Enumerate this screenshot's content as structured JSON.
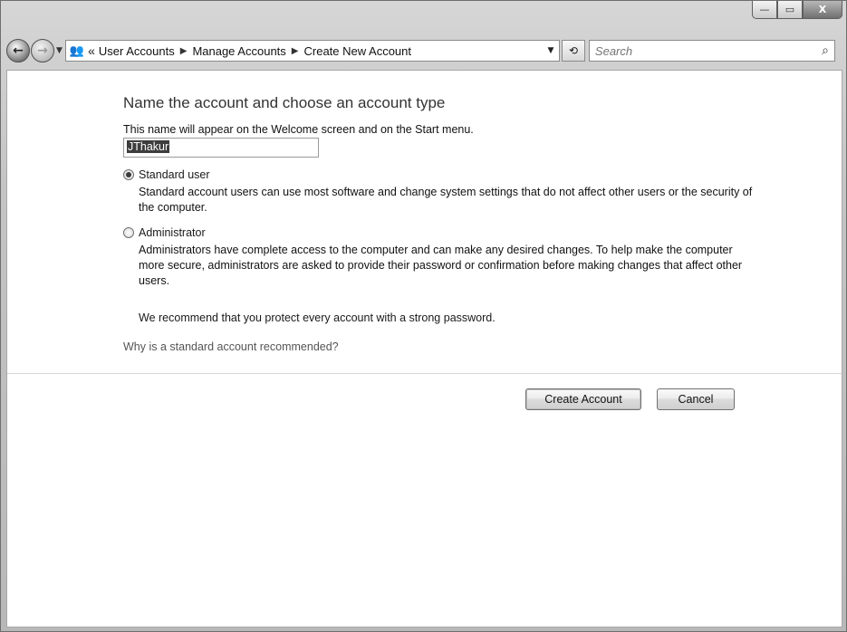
{
  "window": {
    "controls": {
      "minimize": "—",
      "maximize": "▭",
      "close": "X"
    }
  },
  "navbar": {
    "back_icon": "back-arrow-icon",
    "forward_icon": "forward-arrow-icon",
    "address_icon": "users-icon",
    "overflow_chevron": "«",
    "breadcrumbs": [
      "User Accounts",
      "Manage Accounts",
      "Create New Account"
    ],
    "search_placeholder": "Search"
  },
  "form": {
    "heading": "Name the account and choose an account type",
    "description": "This name will appear on the Welcome screen and on the Start menu.",
    "account_name": "JThakur",
    "options": [
      {
        "label": "Standard user",
        "checked": true,
        "description": "Standard account users can use most software and change system settings that do not affect other users or the security of the computer."
      },
      {
        "label": "Administrator",
        "checked": false,
        "description": "Administrators have complete access to the computer and can make any desired changes. To help make the computer more secure, administrators are asked to provide their password or confirmation before making changes that affect other users."
      }
    ],
    "recommendation": "We recommend that you protect every account with a strong password.",
    "help_link": "Why is a standard account recommended?",
    "create_button": "Create Account",
    "cancel_button": "Cancel"
  }
}
